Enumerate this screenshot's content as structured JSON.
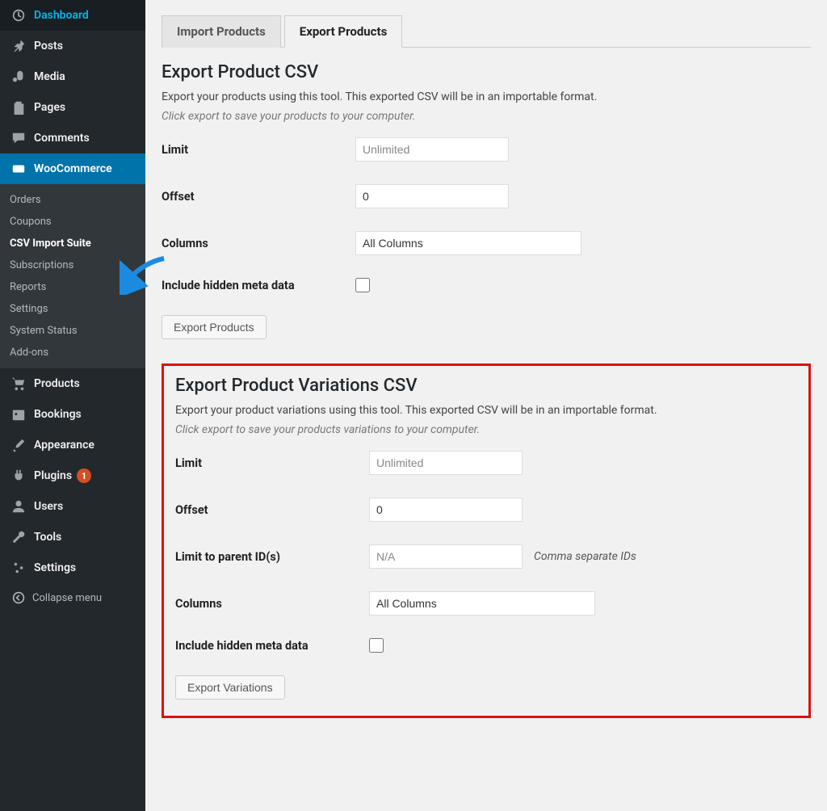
{
  "sidebar": {
    "items": [
      {
        "label": "Dashboard",
        "icon": "dashboard"
      },
      {
        "label": "Posts",
        "icon": "pin"
      },
      {
        "label": "Media",
        "icon": "media"
      },
      {
        "label": "Pages",
        "icon": "pages"
      },
      {
        "label": "Comments",
        "icon": "comment"
      },
      {
        "label": "WooCommerce",
        "icon": "woo"
      },
      {
        "label": "Products",
        "icon": "cart"
      },
      {
        "label": "Bookings",
        "icon": "calendar"
      },
      {
        "label": "Appearance",
        "icon": "brush"
      },
      {
        "label": "Plugins",
        "icon": "plug",
        "badge": "1"
      },
      {
        "label": "Users",
        "icon": "user"
      },
      {
        "label": "Tools",
        "icon": "wrench"
      },
      {
        "label": "Settings",
        "icon": "sliders"
      }
    ],
    "woo_submenu": [
      "Orders",
      "Coupons",
      "CSV Import Suite",
      "Subscriptions",
      "Reports",
      "Settings",
      "System Status",
      "Add-ons"
    ],
    "collapse_label": "Collapse menu"
  },
  "tabs": {
    "import": "Import Products",
    "export": "Export Products"
  },
  "section1": {
    "title": "Export Product CSV",
    "desc": "Export your products using this tool. This exported CSV will be in an importable format.",
    "hint": "Click export to save your products to your computer.",
    "limit_label": "Limit",
    "limit_placeholder": "Unlimited",
    "offset_label": "Offset",
    "offset_value": "0",
    "columns_label": "Columns",
    "columns_value": "All Columns",
    "hidden_label": "Include hidden meta data",
    "button": "Export Products"
  },
  "section2": {
    "title": "Export Product Variations CSV",
    "desc": "Export your product variations using this tool. This exported CSV will be in an importable format.",
    "hint": "Click export to save your products variations to your computer.",
    "limit_label": "Limit",
    "limit_placeholder": "Unlimited",
    "offset_label": "Offset",
    "offset_value": "0",
    "parent_label": "Limit to parent ID(s)",
    "parent_placeholder": "N/A",
    "parent_after": "Comma separate IDs",
    "columns_label": "Columns",
    "columns_value": "All Columns",
    "hidden_label": "Include hidden meta data",
    "button": "Export Variations"
  }
}
